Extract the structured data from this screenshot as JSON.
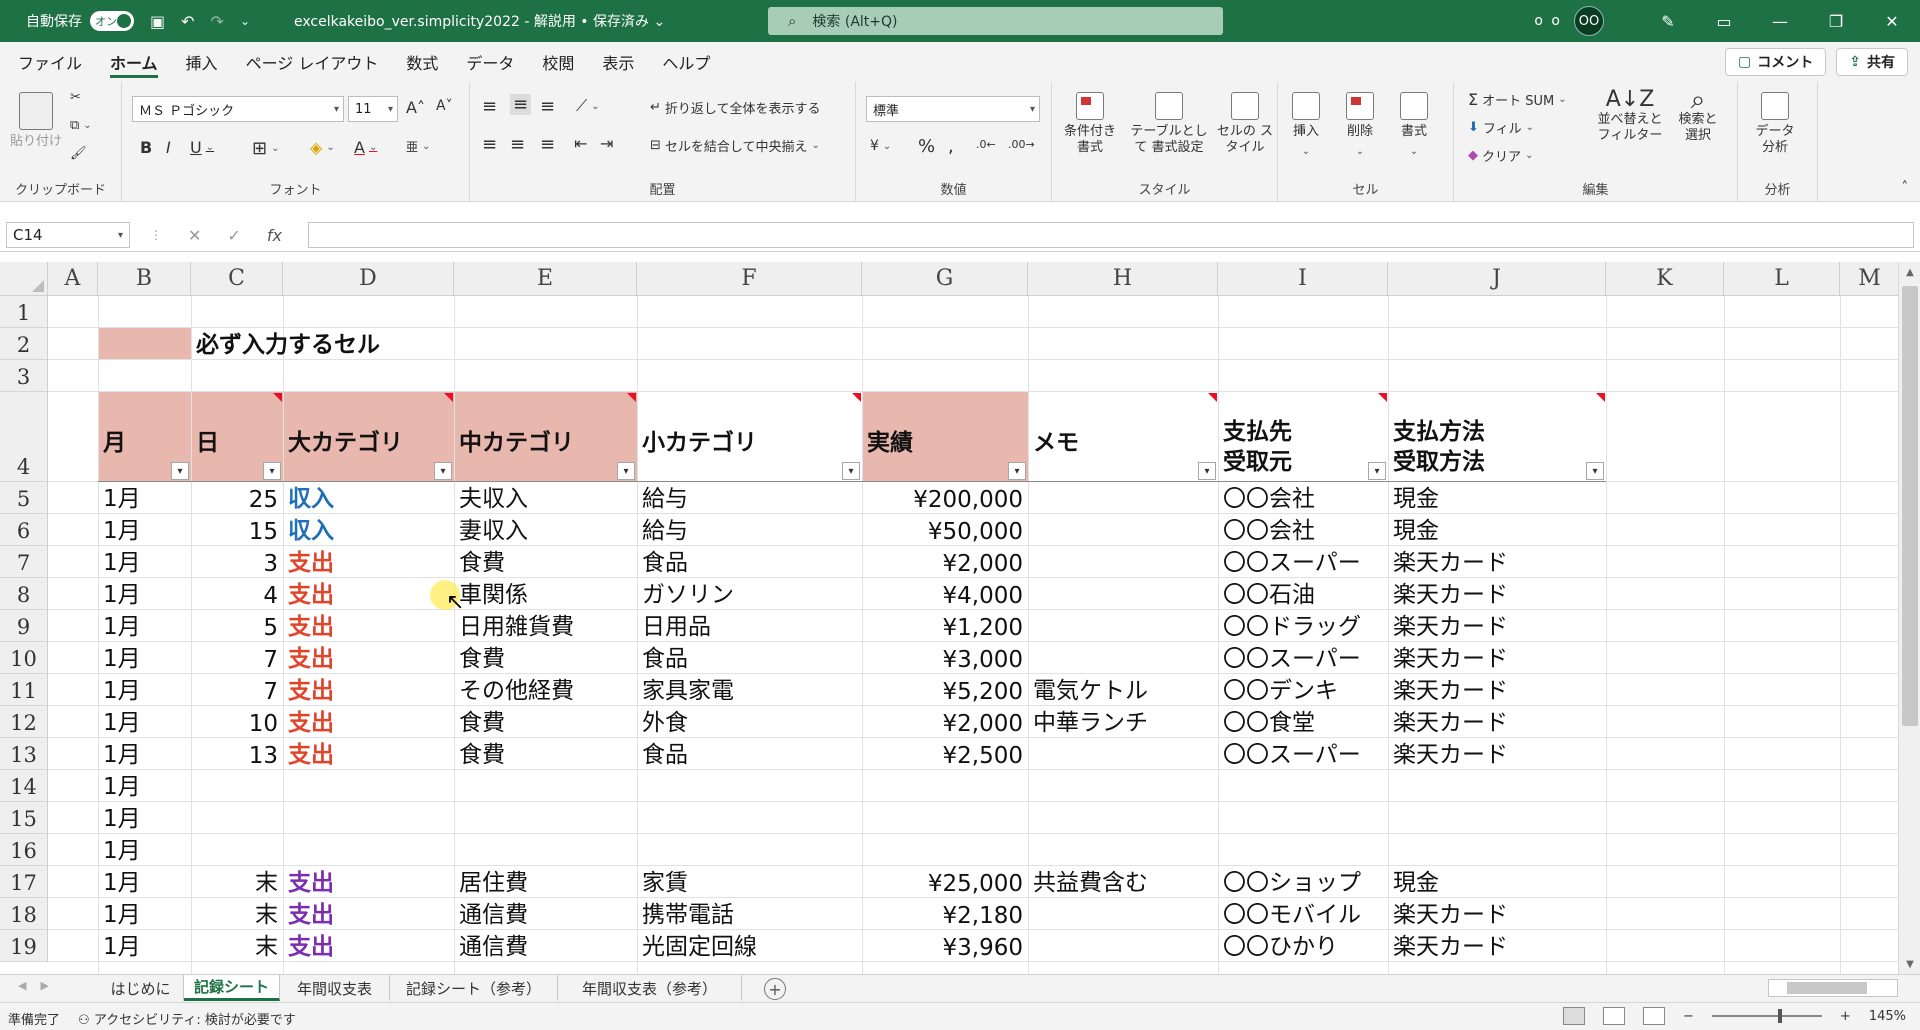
{
  "titlebar": {
    "autosave_label": "自動保存",
    "autosave_state": "オン",
    "filename": "excelkakeibo_ver.simplicity2022 - 解説用 • 保存済み ⌄",
    "search_placeholder": "検索 (Alt+Q)",
    "user_initials_text": "o o",
    "avatar_initials": "OO"
  },
  "menu": {
    "tabs": [
      "ファイル",
      "ホーム",
      "挿入",
      "ページ レイアウト",
      "数式",
      "データ",
      "校閲",
      "表示",
      "ヘルプ"
    ],
    "comment_button": "コメント",
    "share_button": "共有"
  },
  "ribbon": {
    "clipboard": {
      "label": "クリップボード",
      "paste": "貼り付け"
    },
    "font": {
      "label": "フォント",
      "font_name": "ＭＳ Ｐゴシック",
      "font_size": "11"
    },
    "alignment": {
      "label": "配置",
      "wrap": "折り返して全体を表示する",
      "merge": "セルを結合して中央揃え"
    },
    "number": {
      "label": "数値",
      "format": "標準"
    },
    "styles": {
      "label": "スタイル",
      "conditional": "条件付き 書式",
      "table": "テーブルとして 書式設定",
      "cell_style": "セルの スタイル"
    },
    "cells": {
      "label": "セル",
      "insert": "挿入",
      "delete": "削除",
      "format": "書式"
    },
    "editing": {
      "label": "編集",
      "autosum": "オート SUM",
      "fill": "フィル",
      "clear": "クリア",
      "sort": "並べ替えと フィルター",
      "find": "検索と 選択"
    },
    "analysis": {
      "label": "分析",
      "data_analysis": "データ 分析"
    }
  },
  "formula_bar": {
    "name_box": "C14",
    "fx": "fx",
    "content": ""
  },
  "sheet": {
    "columns": [
      "A",
      "B",
      "C",
      "D",
      "E",
      "F",
      "G",
      "H",
      "I",
      "J",
      "K",
      "L",
      "M"
    ],
    "rows": [
      "1",
      "2",
      "3",
      "4",
      "5",
      "6",
      "7",
      "8",
      "9",
      "10",
      "11",
      "12",
      "13",
      "14",
      "15",
      "16",
      "17",
      "18",
      "19"
    ],
    "note_label": "必ず入力するセル",
    "headers": [
      "月",
      "日",
      "大カテゴリ",
      "中カテゴリ",
      "小カテゴリ",
      "実績",
      "メモ",
      "支払先",
      "受取元",
      "支払方法",
      "受取方法"
    ],
    "data": [
      [
        "1月",
        "25",
        "収入",
        "夫収入",
        "給与",
        "¥200,000",
        "",
        "〇〇会社",
        "現金"
      ],
      [
        "1月",
        "15",
        "収入",
        "妻収入",
        "給与",
        "¥50,000",
        "",
        "〇〇会社",
        "現金"
      ],
      [
        "1月",
        "3",
        "支出",
        "食費",
        "食品",
        "¥2,000",
        "",
        "〇〇スーパー",
        "楽天カード"
      ],
      [
        "1月",
        "4",
        "支出",
        "車関係",
        "ガソリン",
        "¥4,000",
        "",
        "〇〇石油",
        "楽天カード"
      ],
      [
        "1月",
        "5",
        "支出",
        "日用雑貨費",
        "日用品",
        "¥1,200",
        "",
        "〇〇ドラッグ",
        "楽天カード"
      ],
      [
        "1月",
        "7",
        "支出",
        "食費",
        "食品",
        "¥3,000",
        "",
        "〇〇スーパー",
        "楽天カード"
      ],
      [
        "1月",
        "7",
        "支出",
        "その他経費",
        "家具家電",
        "¥5,200",
        "電気ケトル",
        "〇〇デンキ",
        "楽天カード"
      ],
      [
        "1月",
        "10",
        "支出",
        "食費",
        "外食",
        "¥2,000",
        "中華ランチ",
        "〇〇食堂",
        "楽天カード"
      ],
      [
        "1月",
        "13",
        "支出",
        "食費",
        "食品",
        "¥2,500",
        "",
        "〇〇スーパー",
        "楽天カード"
      ],
      [
        "1月",
        "",
        "",
        "",
        "",
        "",
        "",
        "",
        ""
      ],
      [
        "1月",
        "",
        "",
        "",
        "",
        "",
        "",
        "",
        ""
      ],
      [
        "1月",
        "",
        "",
        "",
        "",
        "",
        "",
        "",
        ""
      ],
      [
        "1月",
        "末",
        "支出",
        "居住費",
        "家賃",
        "¥25,000",
        "共益費含む",
        "〇〇ショップ",
        "現金"
      ],
      [
        "1月",
        "末",
        "支出",
        "通信費",
        "携帯電話",
        "¥2,180",
        "",
        "〇〇モバイル",
        "楽天カード"
      ],
      [
        "1月",
        "末",
        "支出",
        "通信費",
        "光固定回線",
        "¥3,960",
        "",
        "〇〇ひかり",
        "楽天カード"
      ]
    ]
  },
  "sheet_tabs": [
    "はじめに",
    "記録シート",
    "年間収支表",
    "記録シート（参考）",
    "年間収支表（参考）"
  ],
  "active_sheet": "記録シート",
  "status": {
    "ready": "準備完了",
    "accessibility": "アクセシビリティ: 検討が必要です",
    "zoom": "145%"
  },
  "colors": {
    "excel_green": "#1e7145",
    "required_fill": "#e8b8ae",
    "income": "#1f6fb8",
    "expense": "#e0452c",
    "fixed_expense": "#7a2db0"
  }
}
